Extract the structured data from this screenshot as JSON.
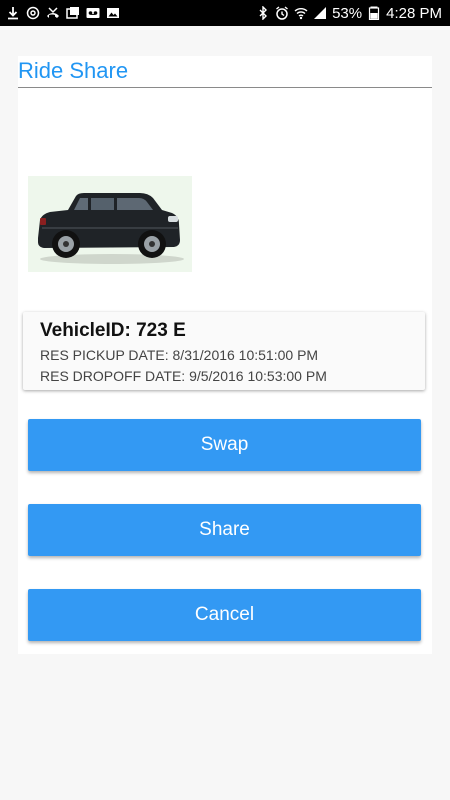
{
  "status_bar": {
    "battery_percent": "53%",
    "time": "4:28 PM"
  },
  "header": {
    "title": "Ride Share"
  },
  "vehicle": {
    "id_text": "VehicleID: 723 E",
    "pickup_text": "RES PICKUP DATE: 8/31/2016 10:51:00 PM",
    "dropoff_text": "RES DROPOFF DATE: 9/5/2016 10:53:00 PM",
    "image_icon": "suv-car-image"
  },
  "actions": {
    "swap_label": "Swap",
    "share_label": "Share",
    "cancel_label": "Cancel"
  },
  "colors": {
    "accent": "#2196f3",
    "button": "#3399f3",
    "status_bar": "#000000"
  }
}
